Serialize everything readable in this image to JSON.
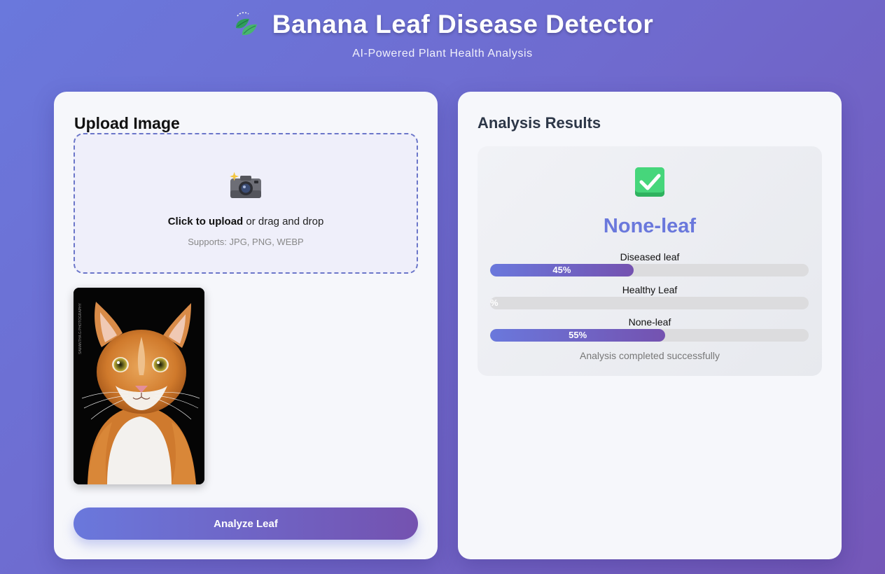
{
  "header": {
    "title": "Banana Leaf Disease Detector",
    "subtitle": "AI-Powered Plant Health Analysis",
    "icon": "leaf-icon"
  },
  "upload": {
    "title": "Upload Image",
    "click_label": "Click to upload",
    "drag_label": " or drag and drop",
    "formats": "Supports: JPG, PNG, WEBP",
    "icon": "camera-icon"
  },
  "preview": {
    "watermark": "SAMANTHA G PHOTOGRAPHY"
  },
  "actions": {
    "analyze_label": "Analyze Leaf"
  },
  "results": {
    "title": "Analysis Results",
    "icon": "check-icon",
    "prediction": "None-leaf",
    "classes": [
      {
        "label": "Diseased leaf",
        "percent": 45,
        "text": "45%"
      },
      {
        "label": "Healthy Leaf",
        "percent": 0,
        "text": "%"
      },
      {
        "label": "None-leaf",
        "percent": 55,
        "text": "55%"
      }
    ],
    "status": "Analysis completed successfully"
  },
  "colors": {
    "accent": "#6a78dc",
    "accent_dark": "#7452b0",
    "check_green": "#3ecf73"
  }
}
